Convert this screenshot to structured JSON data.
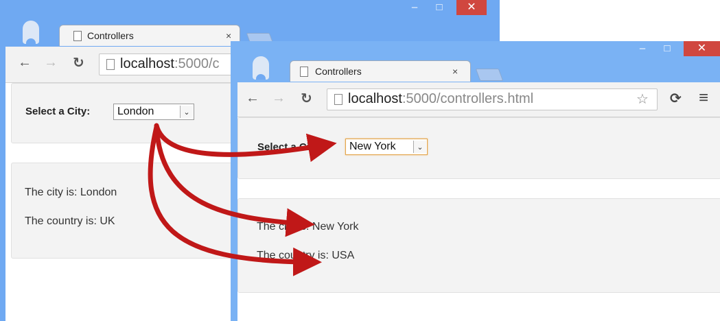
{
  "back_window": {
    "tab_title": "Controllers",
    "tab_close": "×",
    "url_host": "localhost",
    "url_path": ":5000/c",
    "min_label": "–",
    "max_label": "□",
    "close_label": "✕",
    "select_label": "Select a City:",
    "select_value": "London",
    "city_line": "The city is: London",
    "country_line": "The country is: UK"
  },
  "front_window": {
    "tab_title": "Controllers",
    "tab_close": "×",
    "url_host": "localhost",
    "url_path": ":5000/controllers.html",
    "min_label": "–",
    "max_label": "□",
    "close_label": "✕",
    "select_label": "Select a City:",
    "select_value": "New York",
    "city_line": "The city is: New York",
    "country_line": "The country is: USA"
  },
  "icons": {
    "back": "←",
    "forward": "→",
    "reload": "↻",
    "star": "☆",
    "extension": "⟳",
    "menu": "≡",
    "dropdown": "⌄"
  },
  "colors": {
    "window_frame": "#6fa9f2",
    "close_button": "#d0473f",
    "arrow": "#c01818",
    "focus_border": "#e3a44a"
  }
}
